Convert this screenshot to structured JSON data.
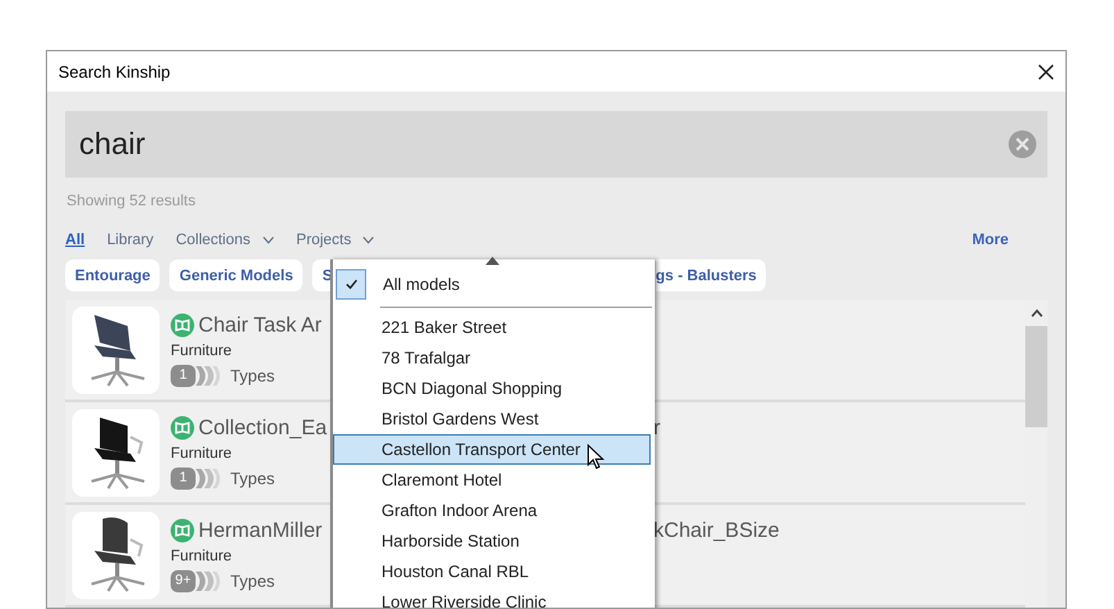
{
  "window": {
    "title": "Search Kinship"
  },
  "search": {
    "value": "chair"
  },
  "result_count": "Showing 52 results",
  "filters": [
    {
      "label": "All",
      "selected": true,
      "dropdown": false
    },
    {
      "label": "Library",
      "selected": false,
      "dropdown": false
    },
    {
      "label": "Collections",
      "selected": false,
      "dropdown": true
    },
    {
      "label": "Projects",
      "selected": false,
      "dropdown": true
    }
  ],
  "more": "More",
  "chips": [
    {
      "label": "Entourage"
    },
    {
      "label": "Generic Models"
    },
    {
      "label": "S"
    },
    {
      "label": "gs - Balusters"
    }
  ],
  "results": [
    {
      "title_left": "Chair Task Ar",
      "category": "Furniture",
      "count": "1",
      "types_label": "Types"
    },
    {
      "title_left": "Collection_Ea",
      "title_right": "r",
      "category": "Furniture",
      "count": "1",
      "types_label": "Types"
    },
    {
      "title_left": "HermanMiller",
      "title_right": "kChair_BSize",
      "category": "Furniture",
      "count": "9+",
      "types_label": "Types"
    }
  ],
  "projects_menu": {
    "all_item": {
      "label": "All models",
      "checked": true
    },
    "items": [
      {
        "label": "221 Baker Street",
        "selected": false
      },
      {
        "label": "78 Trafalgar",
        "selected": false
      },
      {
        "label": "BCN Diagonal Shopping",
        "selected": false
      },
      {
        "label": "Bristol Gardens West",
        "selected": false
      },
      {
        "label": "Castellon Transport Center",
        "selected": true
      },
      {
        "label": "Claremont Hotel",
        "selected": false
      },
      {
        "label": "Grafton Indoor Arena",
        "selected": false
      },
      {
        "label": "Harborside Station",
        "selected": false
      },
      {
        "label": "Houston Canal RBL",
        "selected": false
      },
      {
        "label": "Lower Riverside Clinic",
        "selected": false
      }
    ]
  }
}
